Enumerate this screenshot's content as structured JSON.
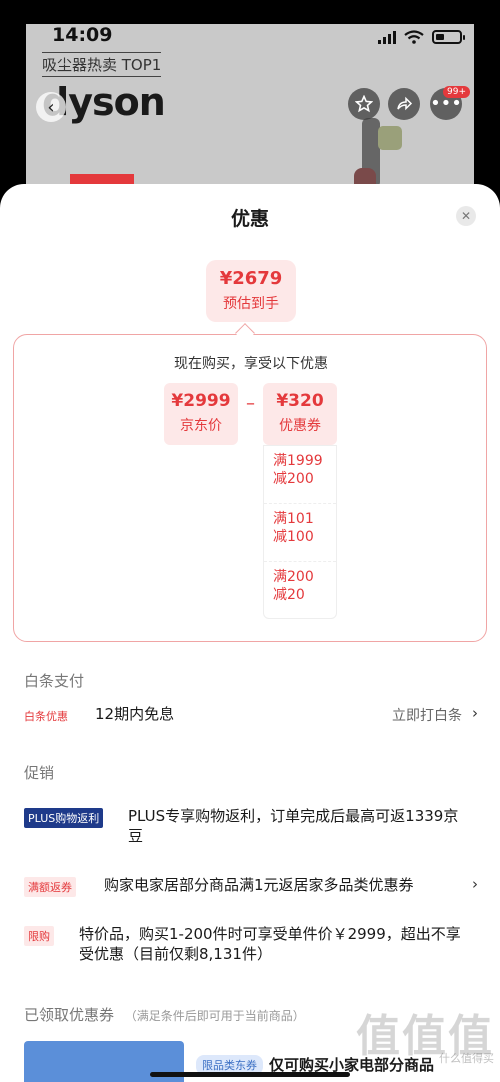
{
  "status_bar": {
    "time": "14:09"
  },
  "product_page": {
    "hot_label": "吸尘器热卖 TOP1",
    "brand": "dyson",
    "cart_badge": "99+",
    "back_icon": "chevron-left-icon",
    "favorite_icon": "star-icon",
    "share_icon": "share-icon",
    "more_icon": "ellipsis-icon"
  },
  "sheet": {
    "title": "优惠",
    "estimate": {
      "price": "¥2679",
      "label": "预估到手"
    },
    "detail": {
      "title": "现在购买，享受以下优惠",
      "jd_price": {
        "value": "¥2999",
        "label": "京东价"
      },
      "minus": "–",
      "coupon_total": {
        "value": "¥320",
        "label": "优惠券"
      },
      "coupons": [
        {
          "line1": "满1999",
          "line2": "减200"
        },
        {
          "line1": "满101",
          "line2": "减100"
        },
        {
          "line1": "满200",
          "line2": "减20"
        }
      ]
    },
    "baitiao": {
      "section": "白条支付",
      "tag": "白条优惠",
      "text": "12期内免息",
      "action": "立即打白条"
    },
    "promo": {
      "section": "促销",
      "items": [
        {
          "tag": "PLUS购物返利",
          "text": "PLUS专享购物返利，订单完成后最高可返1339京豆"
        },
        {
          "tag": "满额返券",
          "text": "购家电家居部分商品满1元返居家多品类优惠券"
        },
        {
          "tag": "限购",
          "text": "特价品，购买1-200件时可享受单件价￥2999，超出不享受优惠（目前仅剩8,131件）"
        }
      ]
    },
    "received": {
      "section": "已领取优惠券",
      "hint": "（满足条件后即可用于当前商品）",
      "coupon_tag": "限品类东券",
      "coupon_text": "仅可购买小家电部分商品"
    }
  },
  "watermark": {
    "text": "值值值",
    "sub": "什么值得买"
  },
  "colors": {
    "accent": "#e4393c",
    "plus_blue": "#1e3a8a",
    "sheet_bg": "#ffffff"
  }
}
